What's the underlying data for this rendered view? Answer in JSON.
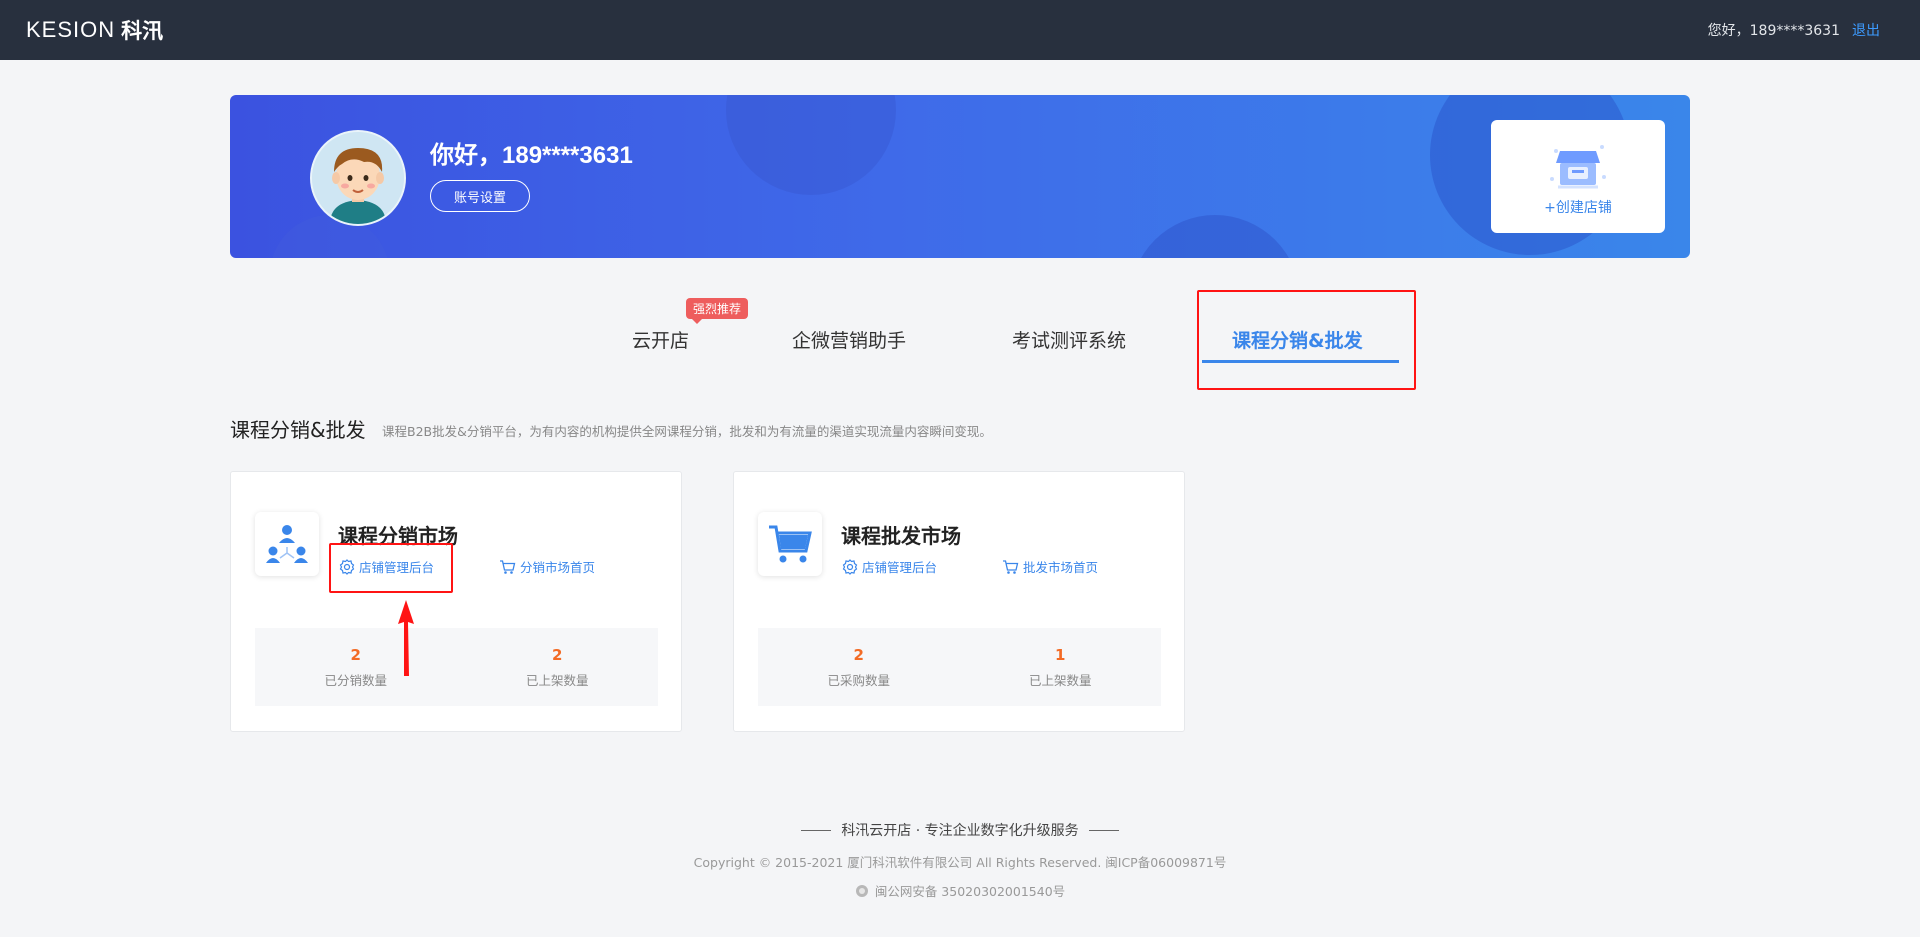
{
  "brand": {
    "logo_en": "KESION",
    "logo_cn": "科汛"
  },
  "header": {
    "user_greeting": "您好，189****3631",
    "logout_label": "退出"
  },
  "banner": {
    "greeting": "你好，189****3631",
    "account_settings_label": "账号设置",
    "create_store_label": "+创建店铺"
  },
  "tabs": [
    {
      "label": "云开店",
      "badge": "强烈推荐"
    },
    {
      "label": "企微营销助手"
    },
    {
      "label": "考试测评系统"
    },
    {
      "label": "课程分销&批发",
      "active": true
    }
  ],
  "section": {
    "title": "课程分销&批发",
    "description": "课程B2B批发&分销平台，为有内容的机构提供全网课程分销，批发和为有流量的渠道实现流量内容瞬间变现。"
  },
  "cards": [
    {
      "title": "课程分销市场",
      "links": [
        "店铺管理后台",
        "分销市场首页"
      ],
      "stats": [
        {
          "value": "2",
          "label": "已分销数量"
        },
        {
          "value": "2",
          "label": "已上架数量"
        }
      ]
    },
    {
      "title": "课程批发市场",
      "links": [
        "店铺管理后台",
        "批发市场首页"
      ],
      "stats": [
        {
          "value": "2",
          "label": "已采购数量"
        },
        {
          "value": "1",
          "label": "已上架数量"
        }
      ]
    }
  ],
  "footer": {
    "slogan": "科汛云开店 · 专注企业数字化升级服务",
    "copyright": "Copyright © 2015-2021 厦门科汛软件有限公司 All Rights Reserved. 闽ICP备06009871号",
    "police": "闽公网安备 35020302001540号"
  },
  "colors": {
    "accent": "#3a86ea",
    "topbar": "#28303e",
    "stat_number": "#f36b25",
    "highlight": "#ff1414",
    "badge": "#ee5d5d"
  }
}
